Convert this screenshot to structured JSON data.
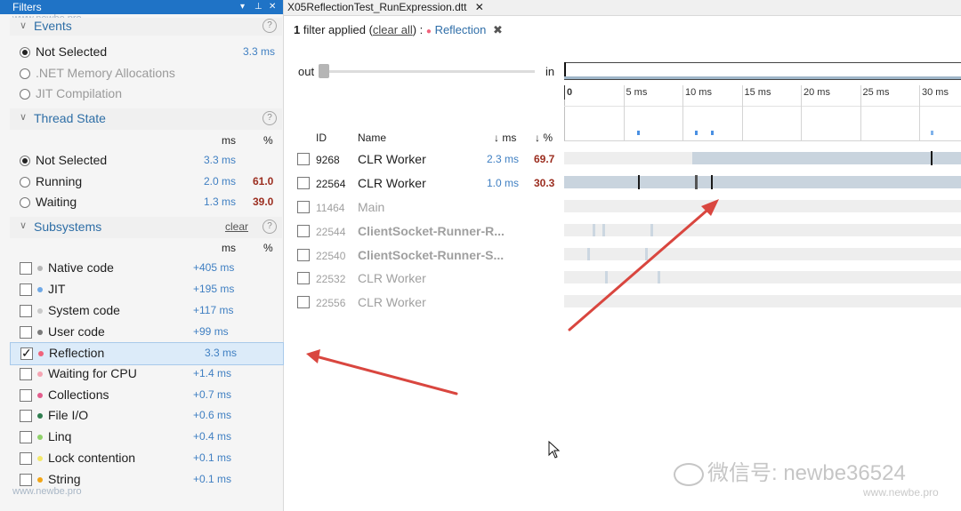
{
  "left_panel": {
    "title": "Filters",
    "pin_icon": "pin-icon",
    "close_icon": "close-icon",
    "watermark": "www.newbe.pro",
    "events": {
      "header": "Events",
      "items": [
        {
          "label": "Not Selected",
          "ms": "3.3 ms",
          "selected": true,
          "disabled": false
        },
        {
          "label": ".NET Memory Allocations",
          "selected": false,
          "disabled": true
        },
        {
          "label": "JIT Compilation",
          "selected": false,
          "disabled": true
        }
      ]
    },
    "thread_state": {
      "header": "Thread State",
      "col_ms": "ms",
      "col_pct": "%",
      "items": [
        {
          "label": "Not Selected",
          "ms": "3.3 ms",
          "pct": "",
          "selected": true
        },
        {
          "label": "Running",
          "ms": "2.0 ms",
          "pct": "61.0",
          "selected": false
        },
        {
          "label": "Waiting",
          "ms": "1.3 ms",
          "pct": "39.0",
          "selected": false
        }
      ]
    },
    "subsystems": {
      "header": "Subsystems",
      "clear": "clear",
      "col_ms": "ms",
      "col_pct": "%",
      "items": [
        {
          "label": "Native code",
          "ms": "+405 ms",
          "color": "#b5b5b5",
          "checked": false
        },
        {
          "label": "JIT",
          "ms": "+195 ms",
          "color": "#6fa8e6",
          "checked": false
        },
        {
          "label": "System code",
          "ms": "+117 ms",
          "color": "#c9c9c9",
          "checked": false
        },
        {
          "label": "User code",
          "ms": "+99 ms",
          "color": "#7a7a7a",
          "checked": false
        },
        {
          "label": "Reflection",
          "ms": "3.3 ms",
          "color": "#f0637b",
          "checked": true
        },
        {
          "label": "Waiting for CPU",
          "ms": "+1.4 ms",
          "color": "#f5a5b3",
          "checked": false
        },
        {
          "label": "Collections",
          "ms": "+0.7 ms",
          "color": "#e35d8c",
          "checked": false
        },
        {
          "label": "File I/O",
          "ms": "+0.6 ms",
          "color": "#2f7d4f",
          "checked": false
        },
        {
          "label": "Linq",
          "ms": "+0.4 ms",
          "color": "#8fd16a",
          "checked": false
        },
        {
          "label": "Lock contention",
          "ms": "+0.1 ms",
          "color": "#f3e86a",
          "checked": false
        },
        {
          "label": "String",
          "ms": "+0.1 ms",
          "color": "#f2a516",
          "checked": false
        }
      ]
    }
  },
  "document": {
    "tab_title": "X05ReflectionTest_RunExpression.dtt",
    "filter_bar": {
      "count": "1",
      "text": "filter applied",
      "clear_all": "clear all",
      "filter_name": "Reflection",
      "filter_color": "#f0637b"
    },
    "zoom": {
      "out_label": "out",
      "in_label": "in"
    },
    "ruler_labels": [
      "0",
      "5 ms",
      "10 ms",
      "15 ms",
      "20 ms",
      "25 ms",
      "30 ms"
    ],
    "columns": {
      "id": "ID",
      "name": "Name",
      "ms": "↓ ms",
      "pct": "↓ %"
    },
    "threads": [
      {
        "id": "9268",
        "name": "CLR Worker",
        "ms": "2.3 ms",
        "pct": "69.7",
        "active": true
      },
      {
        "id": "22564",
        "name": "CLR Worker",
        "ms": "1.0 ms",
        "pct": "30.3",
        "active": true
      },
      {
        "id": "11464",
        "name": "Main",
        "ms": "",
        "pct": "",
        "active": false
      },
      {
        "id": "22544",
        "name": "ClientSocket-Runner-R...",
        "ms": "",
        "pct": "",
        "active": false
      },
      {
        "id": "22540",
        "name": "ClientSocket-Runner-S...",
        "ms": "",
        "pct": "",
        "active": false
      },
      {
        "id": "22532",
        "name": "CLR Worker",
        "ms": "",
        "pct": "",
        "active": false
      },
      {
        "id": "22556",
        "name": "CLR Worker",
        "ms": "",
        "pct": "",
        "active": false
      }
    ],
    "wechat_watermark": "微信号: newbe36524",
    "watermark": "www.newbe.pro"
  }
}
